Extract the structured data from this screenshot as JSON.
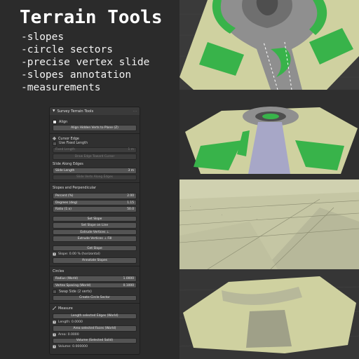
{
  "heading": "Terrain Tools",
  "features": [
    "-slopes",
    "-circle sectors",
    "-precise vertex slide",
    "-slopes annotation",
    "-measurements"
  ],
  "panel": {
    "title": "Survey Terrain Tools",
    "align": {
      "header": "Align",
      "button": "Align Hidden Verts to Plane (Z)"
    },
    "cursor_edge": {
      "header": "Cursor Edge",
      "use_fixed_length": "Use Fixed Length",
      "fixed_length_label": "Fixed Length",
      "fixed_length_value": "1 m",
      "draw_button": "Draw Edge Toward Cursor"
    },
    "slide": {
      "header": "Slide Along Edges",
      "slide_length_label": "Slide Length",
      "slide_length_value": "3 m",
      "slide_button": "Slide Verts Along Edges"
    },
    "slopes": {
      "header": "Slopes and Perpendicular",
      "percent_label": "Percent (%)",
      "percent_value": "2.00",
      "degrees_label": "Degrees (deg)",
      "degrees_value": "1.15",
      "ratio_label": "Ratio (1:x)",
      "ratio_value": "50.0",
      "set_slope": "Set Slope",
      "set_slope_line": "Set Slope on Line",
      "extrude_perp": "Extrude Vertices ⊥",
      "extrude_perp_fill": "Extrude Vertices ⊥ Fill",
      "get_slope": "Get Slope",
      "slope_readout": "Slope: 0.00 % (horizontal)",
      "annotate": "Annotate Slopes"
    },
    "circles": {
      "header": "Circles",
      "radius_label": "Radius (World)",
      "radius_value": "1.0000",
      "spacing_label": "Vertex Spacing (World)",
      "spacing_value": "0.1000",
      "swap_side": "Swap Side (2 verts)",
      "create_button": "Create Circle Sector"
    },
    "measure": {
      "header": "Measure",
      "length_button": "Length selected Edges (World)",
      "length_readout": "Length: 0.0000",
      "area_button": "Area selected Faces (World)",
      "area_readout": "Area: 0.0000",
      "volume_button": "Volume (Selected Solid)",
      "volume_readout": "Volume: 0.000000"
    }
  },
  "colors": {
    "road": "#8f8f8f",
    "terrain": "#cfd1a0",
    "grass": "#38b34a",
    "background": "#2b2b2b"
  }
}
